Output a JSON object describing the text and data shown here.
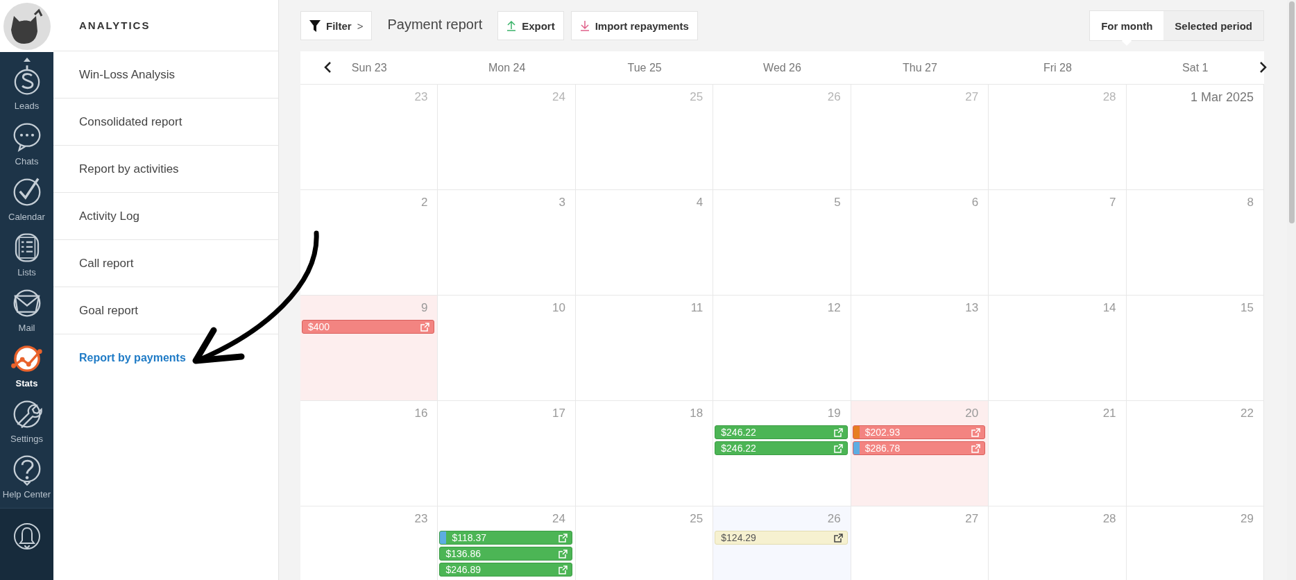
{
  "nav": {
    "items": [
      {
        "label": "Leads",
        "kind": "dollar",
        "selected": false
      },
      {
        "label": "Chats",
        "kind": "chat",
        "selected": false
      },
      {
        "label": "Calendar",
        "kind": "check",
        "selected": false
      },
      {
        "label": "Lists",
        "kind": "list",
        "selected": false
      },
      {
        "label": "Mail",
        "kind": "mail",
        "selected": false
      },
      {
        "label": "Stats",
        "kind": "stats",
        "selected": true
      },
      {
        "label": "Settings",
        "kind": "wrench",
        "selected": false
      },
      {
        "label": "Help Center",
        "kind": "help",
        "selected": false
      }
    ]
  },
  "sidebar": {
    "title": "ANALYTICS",
    "items": [
      {
        "label": "Win-Loss Analysis",
        "selected": false
      },
      {
        "label": "Consolidated report",
        "selected": false
      },
      {
        "label": "Report by activities",
        "selected": false
      },
      {
        "label": "Activity Log",
        "selected": false
      },
      {
        "label": "Call report",
        "selected": false
      },
      {
        "label": "Goal report",
        "selected": false
      },
      {
        "label": "Report by payments",
        "selected": true
      }
    ]
  },
  "toolbar": {
    "filter": "Filter",
    "chevron": ">",
    "title": "Payment report",
    "export": "Export",
    "import": "Import repayments",
    "periods": [
      {
        "label": "For month",
        "selected": true
      },
      {
        "label": "Selected period",
        "selected": false
      }
    ]
  },
  "calendar": {
    "days": [
      "Sun 23",
      "Mon 24",
      "Tue 25",
      "Wed 26",
      "Thu 27",
      "Fri 28",
      "Sat 1"
    ],
    "weeks": [
      [
        {
          "day": "23",
          "muted": true,
          "kind": "plain"
        },
        {
          "day": "24",
          "muted": true,
          "kind": "plain"
        },
        {
          "day": "25",
          "muted": true,
          "kind": "plain"
        },
        {
          "day": "26",
          "muted": true,
          "kind": "plain"
        },
        {
          "day": "27",
          "muted": true,
          "kind": "plain"
        },
        {
          "day": "28",
          "muted": true,
          "kind": "plain"
        },
        {
          "day": "1 Mar 2025",
          "muted": false,
          "kind": "plain"
        }
      ],
      [
        {
          "day": "2",
          "muted": false,
          "kind": "plain"
        },
        {
          "day": "3",
          "muted": false,
          "kind": "plain"
        },
        {
          "day": "4",
          "muted": false,
          "kind": "plain"
        },
        {
          "day": "5",
          "muted": false,
          "kind": "plain"
        },
        {
          "day": "6",
          "muted": false,
          "kind": "plain"
        },
        {
          "day": "7",
          "muted": false,
          "kind": "plain"
        },
        {
          "day": "8",
          "muted": false,
          "kind": "plain"
        }
      ],
      [
        {
          "day": "9",
          "muted": false,
          "kind": "overdue",
          "payments": [
            {
              "amount": "$400",
              "kind": "overdue"
            }
          ]
        },
        {
          "day": "10",
          "muted": false,
          "kind": "plain"
        },
        {
          "day": "11",
          "muted": false,
          "kind": "plain"
        },
        {
          "day": "12",
          "muted": false,
          "kind": "plain"
        },
        {
          "day": "13",
          "muted": false,
          "kind": "plain"
        },
        {
          "day": "14",
          "muted": false,
          "kind": "plain"
        },
        {
          "day": "15",
          "muted": false,
          "kind": "plain"
        }
      ],
      [
        {
          "day": "16",
          "muted": false,
          "kind": "plain"
        },
        {
          "day": "17",
          "muted": false,
          "kind": "plain"
        },
        {
          "day": "18",
          "muted": false,
          "kind": "plain"
        },
        {
          "day": "19",
          "muted": false,
          "kind": "plain",
          "payments": [
            {
              "amount": "$246.22",
              "kind": "paid"
            },
            {
              "amount": "$246.22",
              "kind": "paid"
            }
          ]
        },
        {
          "day": "20",
          "muted": false,
          "kind": "overdue",
          "payments": [
            {
              "amount": "$202.93",
              "kind": "overdue",
              "color": "#e67e22"
            },
            {
              "amount": "$286.78",
              "kind": "overdue",
              "color": "#5dade2"
            }
          ]
        },
        {
          "day": "21",
          "muted": false,
          "kind": "plain"
        },
        {
          "day": "22",
          "muted": false,
          "kind": "plain"
        }
      ],
      [
        {
          "day": "23",
          "muted": false,
          "kind": "plain"
        },
        {
          "day": "24",
          "muted": false,
          "kind": "plain",
          "payments": [
            {
              "amount": "$118.37",
              "kind": "paid",
              "color": "#5dade2"
            },
            {
              "amount": "$136.86",
              "kind": "paid"
            },
            {
              "amount": "$246.89",
              "kind": "paid"
            }
          ]
        },
        {
          "day": "25",
          "muted": false,
          "kind": "plain"
        },
        {
          "day": "26",
          "muted": false,
          "kind": "today",
          "payments": [
            {
              "amount": "$124.29",
              "kind": "planned"
            }
          ]
        },
        {
          "day": "27",
          "muted": false,
          "kind": "plain"
        },
        {
          "day": "28",
          "muted": false,
          "kind": "plain"
        },
        {
          "day": "29",
          "muted": false,
          "kind": "plain"
        }
      ]
    ]
  }
}
